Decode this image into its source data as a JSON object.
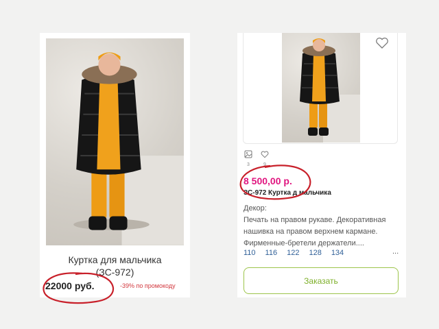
{
  "left_card": {
    "title": "Куртка для мальчика",
    "sku": "(ЗС-972)",
    "price": "22000 руб.",
    "promo": "-39% по промокоду"
  },
  "right_card": {
    "photo_count": "3",
    "like_count": "9",
    "price": "8 500,00 р.",
    "name": "ЗС-972 Куртка д мальчика",
    "description_lines": [
      "Декор:",
      "Печать на правом рукаве. Декоративная",
      "нашивка на правом верхнем кармане.",
      "Фирменные-бретели держатели...."
    ],
    "sizes": [
      "110",
      "116",
      "122",
      "128",
      "134"
    ],
    "more": "...",
    "order_button": "Заказать"
  },
  "colors": {
    "price_accent": "#e0157f",
    "promo_red": "#d2373d",
    "annotation_red": "#c8202a",
    "button_green": "#7daf28",
    "size_link": "#2f5f97",
    "jacket": "#1a1a1a",
    "hoodie_orange": "#f0a11c"
  },
  "icons": {
    "wishlist": "heart-outline-icon",
    "photos": "image-icon",
    "likes": "heart-outline-icon"
  }
}
